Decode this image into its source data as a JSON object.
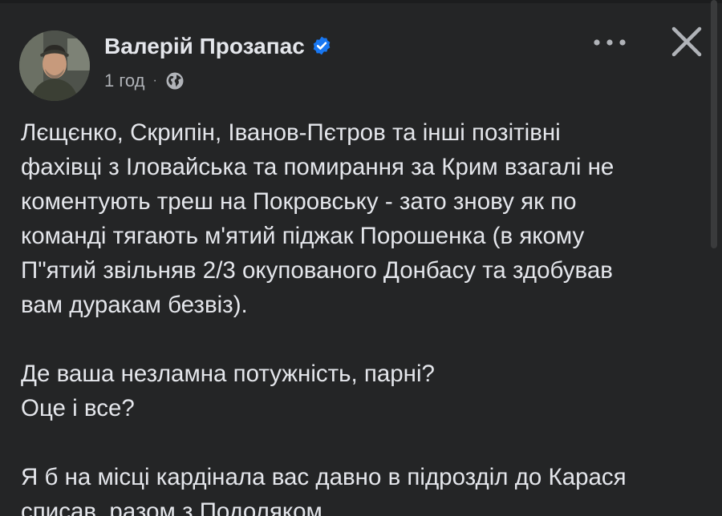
{
  "post": {
    "author": "Валерій Прозапас",
    "time": "1 год",
    "separator": "·",
    "verified_icon": "verified-badge-icon",
    "privacy_icon": "globe-icon",
    "paragraphs": [
      "Лєщєнко, Скрипін, Іванов-Пєтров та інші  позітівні\nфахівці з Іловайська та помирання за Крим взагалі не\nкоментують треш на Покровську - зато знову як по\nкоманді тягають м'ятий піджак Порошенка (в якому\nП\"ятий звільняв 2/3 окупованого Донбасу та здобував\nвам дуракам безвіз).",
      "Де ваша незламна потужність, парні?\nОце і все?",
      "Я б на місці кардінала вас давно в підрозділ до Карася\nсписав, разом з Подоляком."
    ]
  },
  "controls": {
    "more_icon": "more-horizontal-icon",
    "close_icon": "close-icon"
  },
  "colors": {
    "background": "#242526",
    "text": "#e4e6eb",
    "secondary_text": "#b0b3b8",
    "verified": "#1877f2"
  }
}
